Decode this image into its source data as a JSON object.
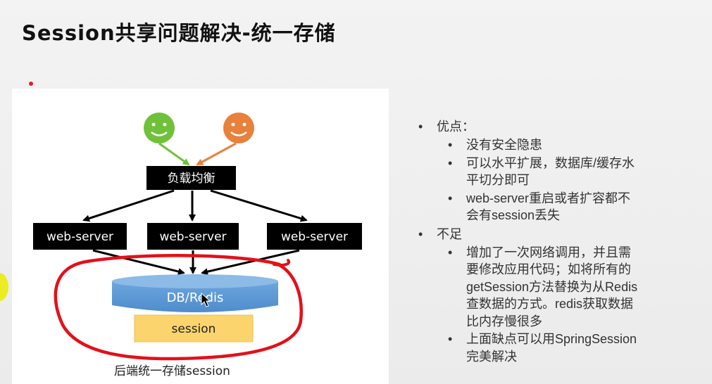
{
  "title": "Session共享问题解决-统一存储",
  "diagram": {
    "load_balancer_label": "负载均衡",
    "servers": [
      "web-server",
      "web-server",
      "web-server"
    ],
    "db_label": "DB/Redis",
    "session_label": "session",
    "caption": "后端统一存储session",
    "colors": {
      "user_green": "#6fc13a",
      "user_orange": "#e8813c",
      "box_black": "#000000",
      "db_blue": "#5b9bd5",
      "session_yellow": "#fbd46d",
      "annotation_red": "#e3101a"
    }
  },
  "bullets": {
    "pros_title": "优点：",
    "pros": [
      [
        "没有安全隐患"
      ],
      [
        "可以水平扩展，数据库/缓存水",
        "平切分即可"
      ],
      [
        "web-server重启或者扩容都不",
        "会有session丢失"
      ]
    ],
    "cons_title": "不足",
    "cons": [
      [
        "增加了一次网络调用，并且需",
        "要修改应用代码；如将所有的",
        "getSession方法替换为从Redis",
        "查数据的方式。redis获取数据",
        "比内存慢很多"
      ],
      [
        "上面缺点可以用SpringSession",
        "完美解决"
      ]
    ],
    "bullet_glyph": "•"
  }
}
